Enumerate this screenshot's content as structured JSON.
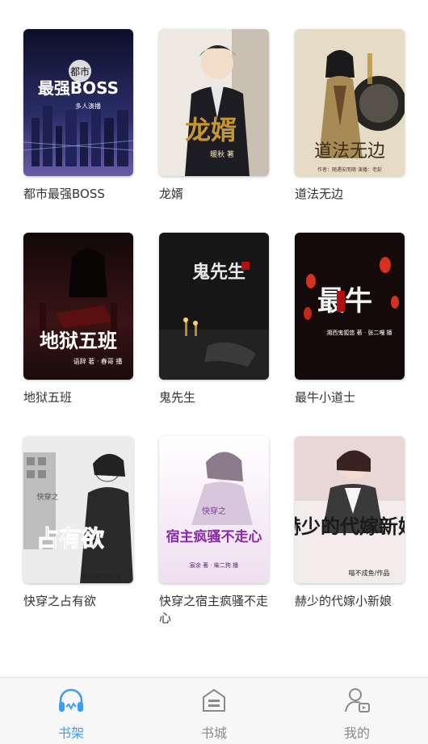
{
  "books": [
    {
      "title": "都市最强BOSS",
      "cover_text": "最强BOSS",
      "cover_sub": "都市",
      "cover_author": "多人演播",
      "theme": "#1b1f3b"
    },
    {
      "title": "龙婿",
      "cover_text": "龙婿",
      "cover_sub": "",
      "cover_author": "暖秋 著",
      "theme": "#e9e3d8"
    },
    {
      "title": "道法无边",
      "cover_text": "道法无边",
      "cover_sub": "",
      "cover_author": "作者：随遇安而随 演播：老彭",
      "theme": "#d8c9a8"
    },
    {
      "title": "地狱五班",
      "cover_text": "地狱五班",
      "cover_sub": "",
      "cover_author": "语辞 著 · 春哥 播",
      "theme": "#2a1414"
    },
    {
      "title": "鬼先生",
      "cover_text": "鬼先生",
      "cover_sub": "",
      "cover_author": "",
      "theme": "#141414"
    },
    {
      "title": "最牛小道士",
      "cover_text": "最牛",
      "cover_sub": "",
      "cover_author": "湘西鬼狐悠 著 · 张二嘎 播",
      "theme": "#1a0f0f"
    },
    {
      "title": "快穿之占有欲",
      "cover_text": "占有欲",
      "cover_sub": "快穿之",
      "cover_author": "小狗&鹅之物 播",
      "theme": "#e8e8e8"
    },
    {
      "title": "快穿之宿主疯骚不走心",
      "cover_text": "宿主疯骚不走心",
      "cover_sub": "快穿之",
      "cover_author": "宸余 著 · 柴二狗 播",
      "theme": "#f3e9f2"
    },
    {
      "title": "赫少的代嫁小新娘",
      "cover_text": "赫少的代嫁新娘",
      "cover_sub": "",
      "cover_author": "喵不成鱼/作品",
      "theme": "#f0e6e6"
    }
  ],
  "tabbar": {
    "tabs": [
      {
        "label": "书架",
        "icon": "headphones-icon",
        "active": true
      },
      {
        "label": "书城",
        "icon": "bookstore-icon",
        "active": false
      },
      {
        "label": "我的",
        "icon": "profile-icon",
        "active": false
      }
    ],
    "active_color": "#3a9ef5",
    "inactive_color": "#8a8a8a"
  }
}
